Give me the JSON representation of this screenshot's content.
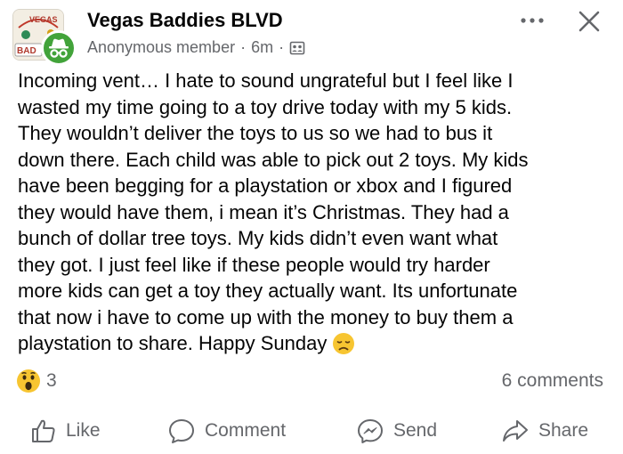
{
  "header": {
    "group_name": "Vegas Baddies BLVD",
    "author": "Anonymous member",
    "separator": "·",
    "time": "6m",
    "group_avatar_text_top": "VEGAS",
    "group_avatar_text_side": "BAD",
    "avatar_icon": "incognito-icon",
    "privacy_icon": "group-members-icon",
    "more_icon": "more-horizontal-icon",
    "close_icon": "close-icon"
  },
  "post": {
    "lines": [
      "Incoming vent… I hate to sound ungrateful but I feel like I",
      "wasted my time going to a toy drive today with my 5 kids.",
      "They wouldn’t deliver the toys to us so we had to bus it",
      "down there. Each child was able to pick out 2 toys. My kids",
      "have been begging for a playstation or xbox and I figured",
      "they would have them, i mean it’s Christmas. They had a",
      "bunch of dollar tree toys. My kids didn’t even want what",
      "they got. I just feel like if these people would try harder",
      "more kids can get a toy they actually want. Its unfortunate",
      "that now i have to come up with the money to buy them a",
      "playstation to share. Happy Sunday"
    ],
    "end_emoji": "disappointed-face-emoji"
  },
  "engagement": {
    "reaction_emoji": "wow-reaction-icon",
    "reaction_count": "3",
    "comments": "6 comments"
  },
  "actions": {
    "like": "Like",
    "comment": "Comment",
    "send": "Send",
    "share": "Share"
  },
  "colors": {
    "text": "#050505",
    "secondary": "#65676b",
    "avatar_green": "#42a33a",
    "reaction_yellow": "#f7c531"
  }
}
